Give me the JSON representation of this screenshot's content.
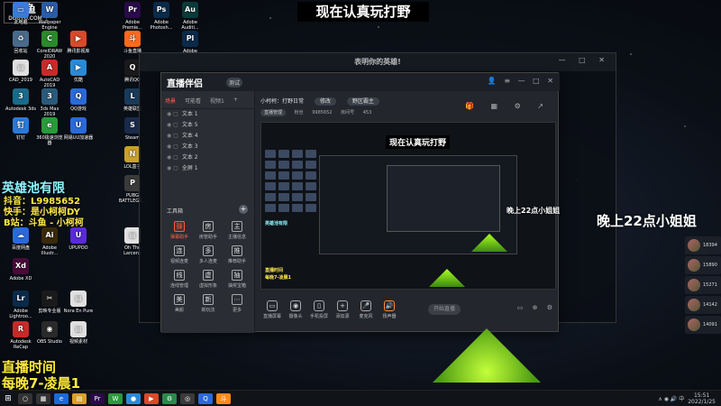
{
  "watermark": {
    "brand": "斗鱼",
    "sub": "DOUYU.COM"
  },
  "top_title": "现在认真玩打野",
  "desktop_icons": [
    {
      "label": "此电脑",
      "glyph": "▭",
      "color": "#3b7bd8"
    },
    {
      "label": "Wallpaper Engine",
      "glyph": "W",
      "color": "#2a5ca8"
    },
    {
      "label": "Adobe Premie...",
      "glyph": "Pr",
      "color": "#2a0a4a"
    },
    {
      "label": "Adobe Photosh...",
      "glyph": "Ps",
      "color": "#0a2a4a"
    },
    {
      "label": "Adobe Auditi...",
      "glyph": "Au",
      "color": "#0a3a3a"
    },
    {
      "label": "Adobe Prelud...",
      "glyph": "Pl",
      "color": "#0a2a4a"
    },
    {
      "label": "回收站",
      "glyph": "♻",
      "color": "#4a6a8a"
    },
    {
      "label": "CorelDRAW 2020",
      "glyph": "C",
      "color": "#2a8a2a"
    },
    {
      "label": "腾讯影视库",
      "glyph": "▶",
      "color": "#d84a2a"
    },
    {
      "label": "斗鱼直播",
      "glyph": "斗",
      "color": "#ff6a1a"
    },
    {
      "label": "CAD_2019",
      "glyph": "▤",
      "color": "#e0e0e0"
    },
    {
      "label": "AutoCAD 2019",
      "glyph": "A",
      "color": "#c82a2a"
    },
    {
      "label": "优酷",
      "glyph": "▶",
      "color": "#2a8ad8"
    },
    {
      "label": "腾讯QQ",
      "glyph": "Q",
      "color": "#1a1a1a"
    },
    {
      "label": "Autodesk 3ds",
      "glyph": "3",
      "color": "#1a6a8a"
    },
    {
      "label": "3ds Max 2019",
      "glyph": "3",
      "color": "#2a5a7a"
    },
    {
      "label": "QQ游戏",
      "glyph": "Q",
      "color": "#2a6ad8"
    },
    {
      "label": "英雄联盟",
      "glyph": "L",
      "color": "#1a3a5a"
    },
    {
      "label": "钉钉",
      "glyph": "钉",
      "color": "#2a7ad8"
    },
    {
      "label": "360极速浏览器",
      "glyph": "e",
      "color": "#2a9a3a"
    },
    {
      "label": "网易UU加速器",
      "glyph": "U",
      "color": "#2a6ad8"
    },
    {
      "label": "Steam",
      "glyph": "S",
      "color": "#1a2a4a"
    },
    {
      "label": "LOL盒子",
      "glyph": "N",
      "color": "#c8a02a"
    },
    {
      "label": "PUBG BATTLEGR...",
      "glyph": "P",
      "color": "#3a3a3a"
    },
    {
      "label": "百度网盘",
      "glyph": "☁",
      "color": "#2a6ad8"
    },
    {
      "label": "Adobe Illustr...",
      "glyph": "Ai",
      "color": "#3a2a0a"
    },
    {
      "label": "UPUPOO",
      "glyph": "U",
      "color": "#5a2ad8"
    },
    {
      "label": "Oh The Larceny",
      "glyph": "▤",
      "color": "#e0e0e0"
    },
    {
      "label": "Adobe XD",
      "glyph": "Xd",
      "color": "#4a0a3a"
    },
    {
      "label": "Adobe Lightroo...",
      "glyph": "Lr",
      "color": "#0a2a4a"
    },
    {
      "label": "剪映专业版",
      "glyph": "✂",
      "color": "#1a1a1a"
    },
    {
      "label": "Nora En Pure",
      "glyph": "▤",
      "color": "#e0e0e0"
    },
    {
      "label": "Autodesk ReCap",
      "glyph": "R",
      "color": "#c82a2a"
    },
    {
      "label": "OBS Studio",
      "glyph": "◉",
      "color": "#2a2a2a"
    },
    {
      "label": "视频素材",
      "glyph": "▤",
      "color": "#e0e0e0"
    }
  ],
  "overlay": {
    "hero": "英雄池有限",
    "douyin": "抖音：L9985652",
    "kuaishou": "快手：是小柯柯DY",
    "bzhan": "B站：斗鱼 - 小柯柯",
    "live_time": "直播时间",
    "live_hours": "每晚7-凌晨1"
  },
  "game_window": {
    "title": "表明你的英雄!",
    "controls": "— □ ✕"
  },
  "zb": {
    "logo": "直播伴侣",
    "version": "测试",
    "window_controls": "👤 ≡ — □ ✕",
    "tabs": [
      "场景",
      "可能看",
      "视频1",
      "+"
    ],
    "scenes": [
      "文本 1",
      "文本 5",
      "文本 4",
      "文本 3",
      "文本 2",
      "全屏 1"
    ],
    "tools_label": "工具箱",
    "tools": [
      {
        "label": "弹幕助手",
        "glyph": "弹",
        "accent": true
      },
      {
        "label": "房管助手",
        "glyph": "房",
        "accent": false
      },
      {
        "label": "主播信息",
        "glyph": "主",
        "accent": false
      },
      {
        "label": "视频连麦",
        "glyph": "连",
        "accent": false
      },
      {
        "label": "多人连麦",
        "glyph": "多",
        "accent": false
      },
      {
        "label": "推荐助手",
        "glyph": "推",
        "accent": false
      },
      {
        "label": "连线管理",
        "glyph": "线",
        "accent": false
      },
      {
        "label": "虚拟形象",
        "glyph": "虚",
        "accent": false
      },
      {
        "label": "抽奖宝箱",
        "glyph": "抽",
        "accent": false
      },
      {
        "label": "美颜",
        "glyph": "美",
        "accent": false
      },
      {
        "label": "新玩法",
        "glyph": "新",
        "accent": false
      },
      {
        "label": "更多",
        "glyph": "⋯",
        "accent": false
      }
    ],
    "info": {
      "room": "小柯柯：打野日常",
      "category": "修改",
      "game": "野区霸主",
      "status": "直播管理",
      "fans_label": "粉丝",
      "fans_value": "9985652",
      "room_label": "房间号",
      "room_value": "453"
    },
    "top_icons": "🎁 ▦ ⚙ ↗",
    "preview_title": "现在认真玩打野",
    "preview_hero": "英雄池有限",
    "preview_live": "直播时间",
    "preview_hours": "每晚7-凌晨1",
    "bottom_tools": [
      {
        "label": "直播屏幕",
        "glyph": "▭",
        "orange": false
      },
      {
        "label": "摄像头",
        "glyph": "◉",
        "orange": false
      },
      {
        "label": "手机投屏",
        "glyph": "▯",
        "orange": false
      },
      {
        "label": "添加源",
        "glyph": "+",
        "orange": false
      },
      {
        "label": "麦克风",
        "glyph": "🎤",
        "orange": false
      },
      {
        "label": "扬声器",
        "glyph": "🔊",
        "orange": true
      }
    ],
    "start_button": "开始直播",
    "right_icons": "▭ ⊕ ⚙"
  },
  "right_overlay": {
    "night": "晚上22点小姐姐",
    "night_small": "晚上22点小姐姐",
    "ranks": [
      "18394",
      "15890",
      "15271",
      "14142",
      "14091"
    ]
  },
  "taskbar": {
    "start": "⊞",
    "apps": [
      {
        "glyph": "○",
        "color": "#333"
      },
      {
        "glyph": "▦",
        "color": "#333"
      },
      {
        "glyph": "e",
        "color": "#1a6ad8"
      },
      {
        "glyph": "▤",
        "color": "#d8a02a"
      },
      {
        "glyph": "Pr",
        "color": "#2a0a4a"
      },
      {
        "glyph": "W",
        "color": "#2a9a3a"
      },
      {
        "glyph": "●",
        "color": "#2a8ad8"
      },
      {
        "glyph": "▶",
        "color": "#d84a2a"
      },
      {
        "glyph": "⚙",
        "color": "#2a8a4a"
      },
      {
        "glyph": "◎",
        "color": "#3a3a3a"
      },
      {
        "glyph": "Q",
        "color": "#2a6ad8"
      },
      {
        "glyph": "斗",
        "color": "#ff8a1a"
      }
    ],
    "tray": "∧ ◉ 🔊 中",
    "time": "15:51",
    "date": "2022/1/25"
  }
}
